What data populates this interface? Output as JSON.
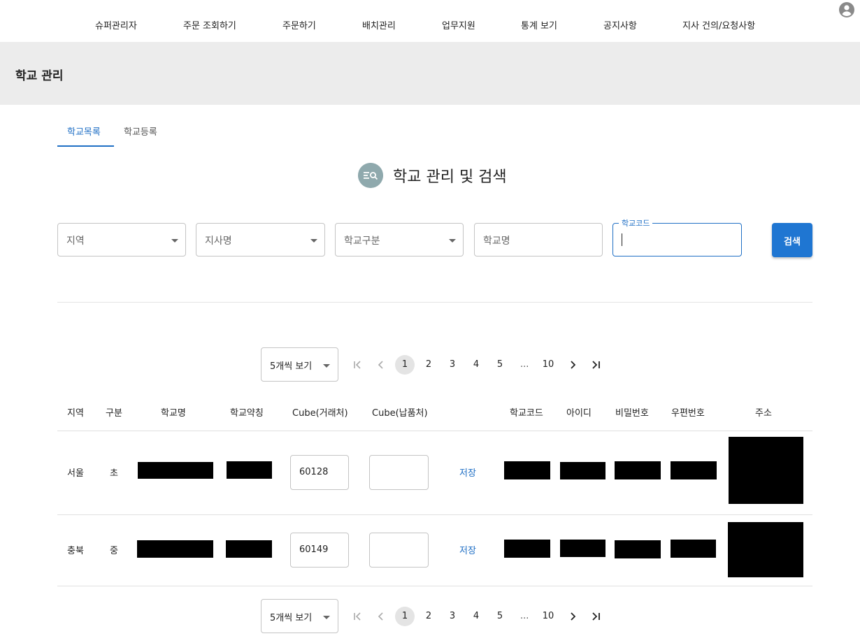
{
  "nav": {
    "items": [
      "슈퍼관리자",
      "주문 조회하기",
      "주문하기",
      "배치관리",
      "업무지원",
      "통계 보기",
      "공지사항",
      "지사 건의/요청사항"
    ]
  },
  "header": {
    "title": "학교 관리"
  },
  "tabs": [
    {
      "label": "학교목록",
      "active": true
    },
    {
      "label": "학교등록",
      "active": false
    }
  ],
  "section": {
    "title": "학교 관리 및 검색"
  },
  "filters": {
    "region": "지역",
    "branch": "지사명",
    "school_type": "학교구분",
    "school_name": "학교명",
    "school_code_label": "학교코드",
    "school_code_value": ""
  },
  "search_button": "검색",
  "pagination": {
    "page_size_label": "5개씩 보기",
    "pages": [
      "1",
      "2",
      "3",
      "4",
      "5"
    ],
    "ellipsis": "...",
    "last_page": "10",
    "current_page": "1"
  },
  "table": {
    "headers": {
      "region": "지역",
      "type": "구분",
      "school_name": "학교명",
      "school_short": "학교약칭",
      "cube_trade": "Cube(거래처)",
      "cube_delivery": "Cube(납품처)",
      "school_code": "학교코드",
      "user_id": "아이디",
      "password": "비밀번호",
      "postal": "우편번호",
      "address": "주소"
    },
    "rows": [
      {
        "region": "서울",
        "type": "초",
        "cube_trade": "60128",
        "cube_delivery": "",
        "save": "저장"
      },
      {
        "region": "충북",
        "type": "중",
        "cube_trade": "60149",
        "cube_delivery": "",
        "save": "저장"
      }
    ]
  },
  "colors": {
    "accent": "#1f6fc5",
    "button": "#1f76d2",
    "band": "#ececec",
    "heading_icon": "#8fa9ad"
  }
}
